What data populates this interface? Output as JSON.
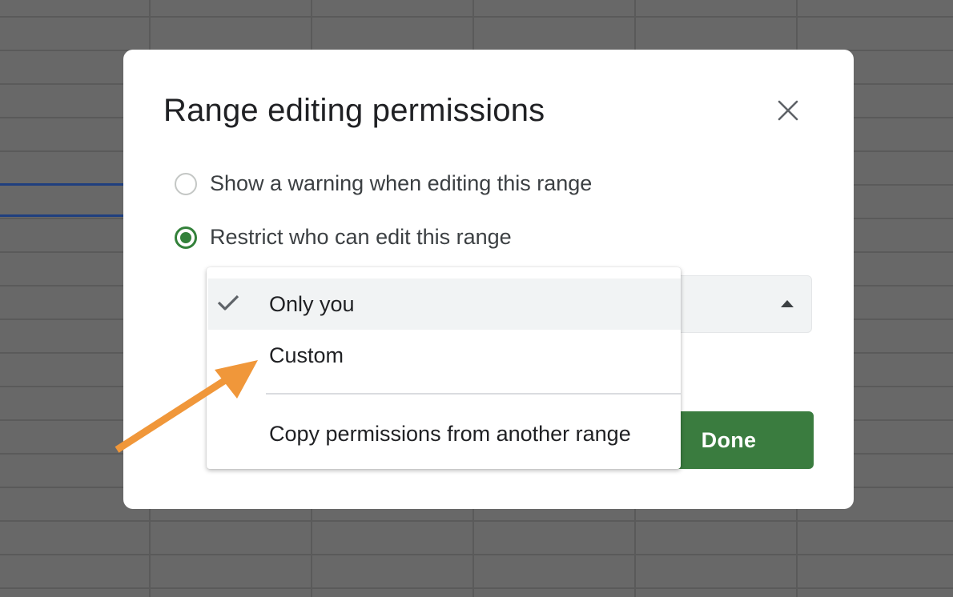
{
  "dialog": {
    "title": "Range editing permissions",
    "close_icon": "close-icon",
    "options": [
      {
        "label": "Show a warning when editing this range",
        "checked": false
      },
      {
        "label": "Restrict who can edit this range",
        "checked": true
      }
    ],
    "done_label": "Done"
  },
  "dropdown": {
    "items": [
      {
        "label": "Only you",
        "selected": true
      },
      {
        "label": "Custom",
        "selected": false
      },
      {
        "label": "Copy permissions from another range",
        "selected": false
      }
    ],
    "check_icon": "check-icon",
    "caret_icon": "caret-up-icon"
  },
  "annotation": {
    "arrow_icon": "orange-arrow-icon",
    "color": "#f0973a"
  },
  "colors": {
    "accent_green": "#3a7c3f",
    "radio_green": "#33813a",
    "backdrop": "#686868"
  }
}
